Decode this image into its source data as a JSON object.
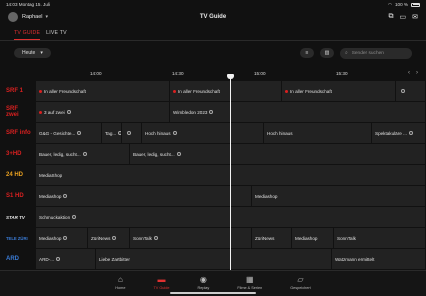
{
  "status": {
    "time": "14:03",
    "date": "Montag 15. Juli",
    "battery": "100 %"
  },
  "header": {
    "user": "Raphael",
    "title": "TV Guide",
    "icons": [
      "cast-icon",
      "share-screen-icon",
      "messages-icon"
    ]
  },
  "tabs": [
    {
      "label": "TV GUIDE",
      "active": true
    },
    {
      "label": "LIVE TV",
      "active": false
    }
  ],
  "filter": {
    "day": "Heute",
    "search_placeholder": "Sender suchen"
  },
  "timeline": {
    "ticks": [
      "14:00",
      "14:30",
      "15:00",
      "15:30"
    ]
  },
  "channels": [
    {
      "logo": "SRF 1",
      "logo_color": "#d92020",
      "programs": [
        {
          "title": "In aller Freundschaft",
          "dot": true
        },
        {
          "title": "In aller Freundschaft",
          "dot": true
        },
        {
          "title": "In aller Freundschaft",
          "dot": true
        },
        {
          "title": "",
          "rec": true
        }
      ]
    },
    {
      "logo": "SRF zwei",
      "logo_color": "#d92020",
      "programs": [
        {
          "title": "3 auf zwei",
          "dot": true,
          "rec": true
        },
        {
          "title": "Wimbledon 2023",
          "rec": true
        }
      ]
    },
    {
      "logo": "SRF info",
      "logo_color": "#d92020",
      "programs": [
        {
          "title": "G&G - Gesichte...",
          "rec": true
        },
        {
          "title": "Tag...",
          "rec": true
        },
        {
          "title": "",
          "rec": true
        },
        {
          "title": "Hoch hinaus",
          "rec": true
        },
        {
          "title": "Hoch hinaus"
        },
        {
          "title": "Spektakuläre ...",
          "rec": true
        }
      ]
    },
    {
      "logo": "3+HD",
      "logo_color": "#d92020",
      "programs": [
        {
          "title": "Bauer, ledig, sucht...",
          "rec": true
        },
        {
          "title": "Bauer, ledig, sucht...",
          "rec": true
        }
      ]
    },
    {
      "logo": "24 HD",
      "logo_color": "#e8a020",
      "programs": [
        {
          "title": "MediaShop"
        }
      ]
    },
    {
      "logo": "S1 HD",
      "logo_color": "#d92020",
      "programs": [
        {
          "title": "Mediashop",
          "rec": true
        },
        {
          "title": "Mediashop"
        }
      ]
    },
    {
      "logo": "STAR TV",
      "logo_color": "#e8e8e8",
      "programs": [
        {
          "title": "Schmuckaktion",
          "rec": true
        }
      ]
    },
    {
      "logo": "TELE ZÜRI",
      "logo_color": "#3a7bd5",
      "programs": [
        {
          "title": "Mediashop",
          "rec": true
        },
        {
          "title": "ZüriNews",
          "rec": true
        },
        {
          "title": "SonnTalk",
          "rec": true
        },
        {
          "title": "ZüriNews"
        },
        {
          "title": "Mediashop"
        },
        {
          "title": "SonnTalk"
        }
      ]
    },
    {
      "logo": "ARD",
      "logo_color": "#3a7bd5",
      "programs": [
        {
          "title": "ARD-...",
          "rec": true
        },
        {
          "title": "Liebe Zartbitter"
        },
        {
          "title": "Watzmann ermittelt"
        }
      ]
    }
  ],
  "bottom_nav": [
    {
      "label": "Home",
      "icon": "home-icon"
    },
    {
      "label": "TV Guide",
      "icon": "tv-guide-icon",
      "active": true
    },
    {
      "label": "Replay",
      "icon": "replay-icon"
    },
    {
      "label": "Filme & Serien",
      "icon": "film-icon"
    },
    {
      "label": "Gespeichert",
      "icon": "saved-folder-icon"
    }
  ]
}
